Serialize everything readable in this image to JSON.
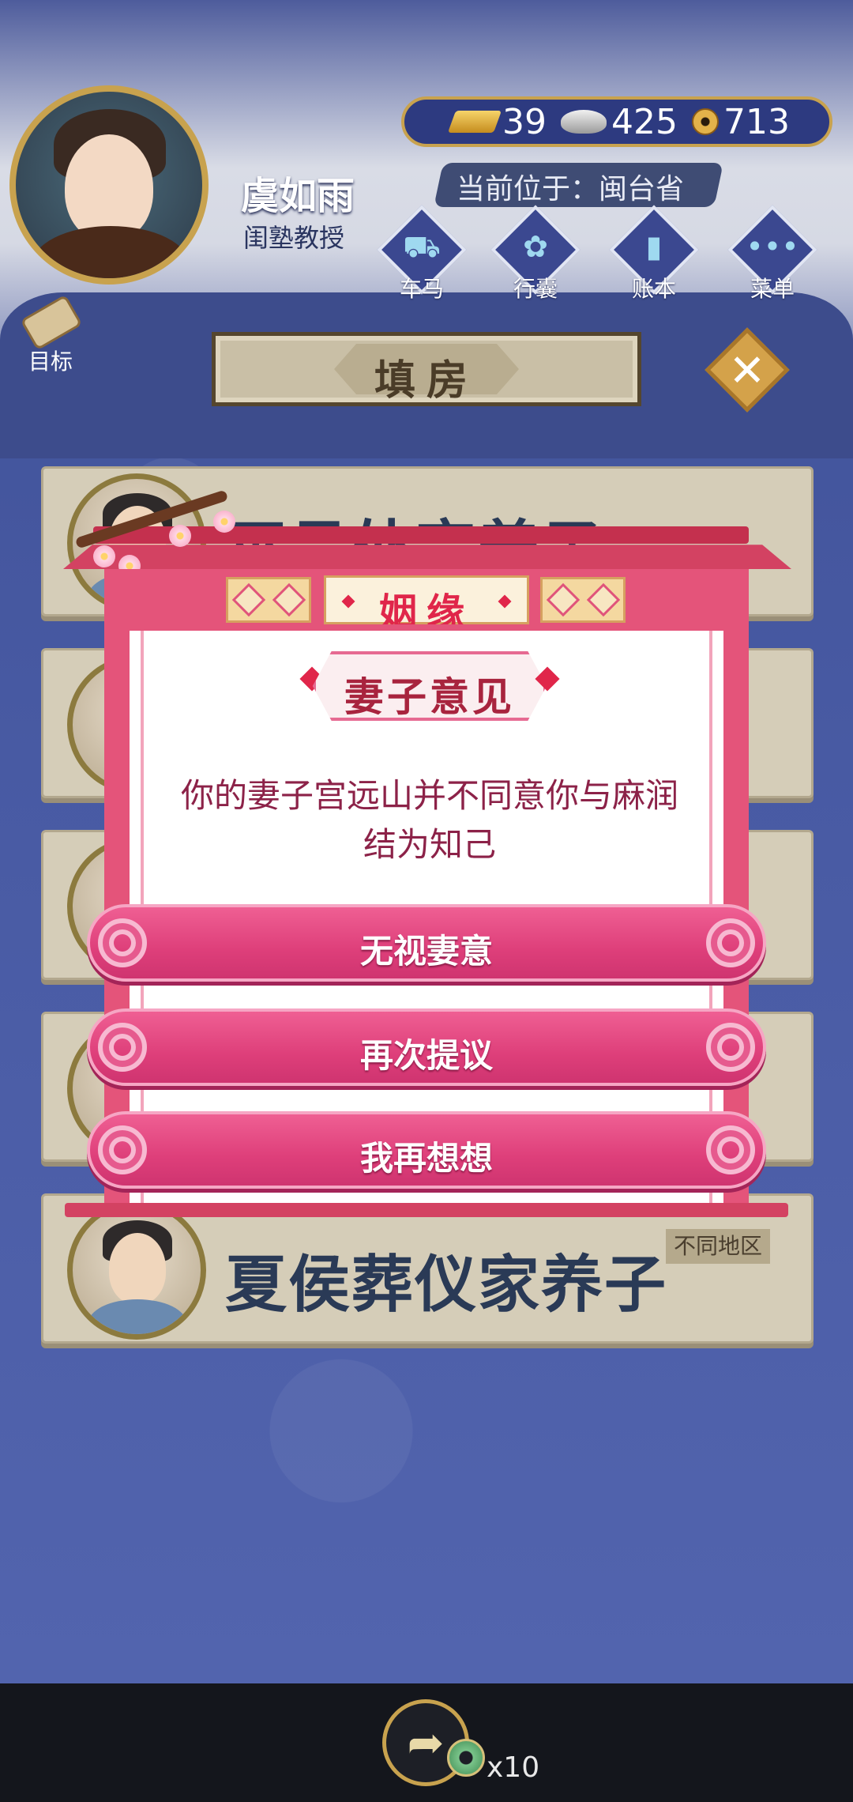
{
  "player": {
    "name": "虞如雨",
    "title": "闺塾教授"
  },
  "currency": {
    "gold": "39",
    "silver": "425",
    "coins": "713"
  },
  "location": {
    "text": "当前位于：闽台省"
  },
  "menu": {
    "items": [
      {
        "label": "车马",
        "icon": "carriage-icon"
      },
      {
        "label": "行囊",
        "icon": "bag-icon"
      },
      {
        "label": "账本",
        "icon": "ledger-icon"
      },
      {
        "label": "菜单",
        "icon": "more-icon"
      }
    ],
    "goal_label": "目标"
  },
  "panel": {
    "title": "填房",
    "close_icon": "close-icon"
  },
  "candidates": [
    {
      "name": "巫吕外宗养子",
      "tag": ""
    },
    {
      "name": "",
      "tag": ""
    },
    {
      "name": "",
      "tag": ""
    },
    {
      "name": "",
      "tag": ""
    },
    {
      "name": "夏侯葬仪家养子",
      "tag": "不同地区"
    }
  ],
  "modal": {
    "header": "姻缘",
    "badge": "妻子意见",
    "message": "你的妻子宫远山并不同意你与麻润结为知己",
    "choices": [
      "无视妻意",
      "再次提议",
      "我再想想"
    ],
    "colors": {
      "accent": "#e4547a",
      "text": "#8c2248"
    }
  },
  "share": {
    "count": "x10",
    "icon": "share-icon"
  }
}
